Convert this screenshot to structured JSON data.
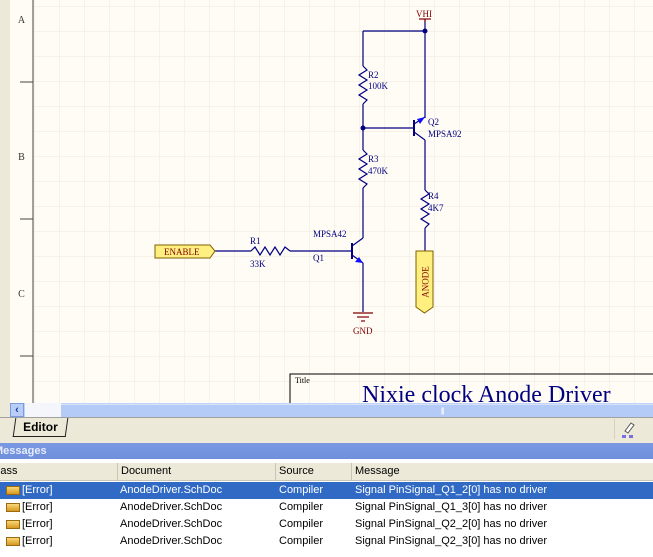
{
  "schematic": {
    "zones": [
      "A",
      "B",
      "C"
    ],
    "net_vhi": "VHI",
    "net_gnd": "GND",
    "port_enable": "ENABLE",
    "port_anode": "ANODE",
    "r1": {
      "ref": "R1",
      "value": "33K"
    },
    "r2": {
      "ref": "R2",
      "value": "100K"
    },
    "r3": {
      "ref": "R3",
      "value": "470K"
    },
    "r4": {
      "ref": "R4",
      "value": "4K7"
    },
    "q1": {
      "ref": "Q1",
      "value": "MPSA42"
    },
    "q2": {
      "ref": "Q2",
      "value": "MPSA92"
    },
    "title_label": "Title",
    "title_value": "Nixie clock Anode Driver",
    "wire_color": "#000080",
    "port_fill": "#ffef80"
  },
  "tabs": [
    {
      "label": "Editor"
    }
  ],
  "messages": {
    "header": "Messages",
    "columns": [
      "Class",
      "Document",
      "Source",
      "Message"
    ],
    "rows": [
      {
        "class": "[Error]",
        "document": "AnodeDriver.SchDoc",
        "source": "Compiler",
        "message": "Signal PinSignal_Q1_2[0] has no driver",
        "selected": true
      },
      {
        "class": "[Error]",
        "document": "AnodeDriver.SchDoc",
        "source": "Compiler",
        "message": "Signal PinSignal_Q1_3[0] has no driver"
      },
      {
        "class": "[Error]",
        "document": "AnodeDriver.SchDoc",
        "source": "Compiler",
        "message": "Signal PinSignal_Q2_2[0] has no driver"
      },
      {
        "class": "[Error]",
        "document": "AnodeDriver.SchDoc",
        "source": "Compiler",
        "message": "Signal PinSignal_Q2_3[0] has no driver"
      }
    ]
  }
}
